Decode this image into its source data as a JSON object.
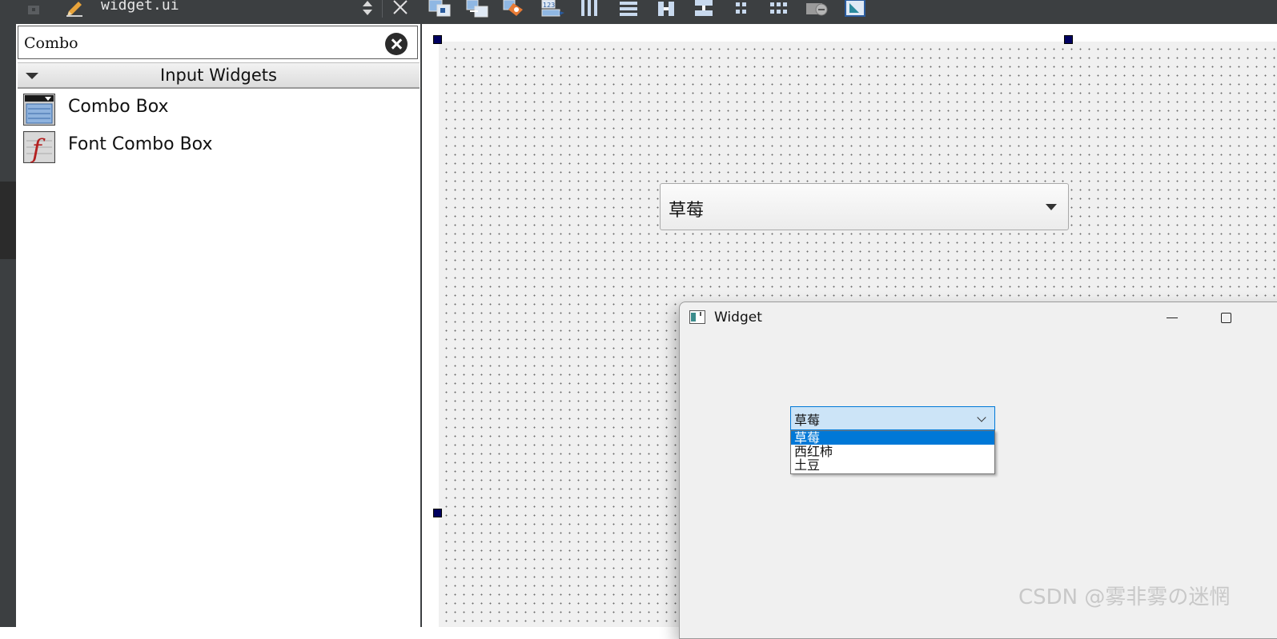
{
  "toolbar": {
    "file_name": "widget.ui",
    "icons": [
      "lock-icon",
      "edit-pencil-icon",
      "switch-file-arrows-icon",
      "close-icon",
      "edit-widgets-icon",
      "edit-signals-slots-icon",
      "edit-buddies-icon",
      "edit-tab-order-icon",
      "layout-horizontal-icon",
      "layout-vertical-icon",
      "splitter-horizontal-icon",
      "splitter-vertical-icon",
      "layout-form-icon",
      "layout-grid-icon",
      "break-layout-icon",
      "adjust-size-icon"
    ]
  },
  "widget_box": {
    "filter_value": "Combo",
    "category": "Input Widgets",
    "items": [
      {
        "label": "Combo Box",
        "icon": "combo-box-icon"
      },
      {
        "label": "Font Combo Box",
        "icon": "font-combo-box-icon"
      }
    ]
  },
  "designer": {
    "combo_value": "草莓"
  },
  "preview_window": {
    "title": "Widget",
    "combo_value": "草莓",
    "options": [
      "草莓",
      "西红柿",
      "土豆"
    ],
    "selected_index": 0
  },
  "watermark": "CSDN @雾非雾の迷惘",
  "colors": {
    "dark_chrome": "#3c3f41",
    "selection": "#0078d7",
    "combo_hover": "#cce4f7",
    "canvas": "#f0f0f0"
  }
}
